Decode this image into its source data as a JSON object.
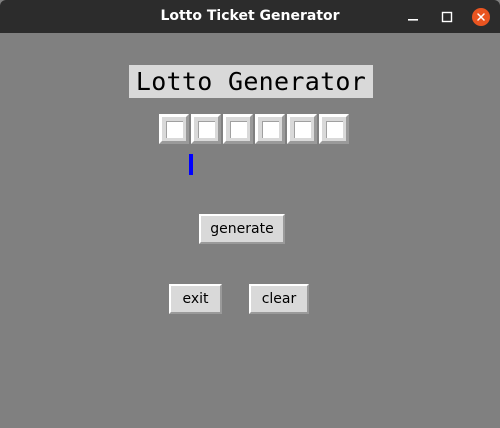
{
  "window": {
    "title": "Lotto Ticket Generator",
    "controls": {
      "minimize_icon": "minimize-icon",
      "maximize_icon": "maximize-icon",
      "close_icon": "close-icon",
      "close_color": "#e95420"
    }
  },
  "app": {
    "heading": "Lotto Generator",
    "slots": [
      "",
      "",
      "",
      "",
      "",
      ""
    ],
    "buttons": {
      "generate": "generate",
      "exit": "exit",
      "clear": "clear"
    }
  },
  "colors": {
    "background": "#808080",
    "widget": "#d9d9d9",
    "cursor": "#0000ff",
    "titlebar": "#2c2c2c"
  }
}
